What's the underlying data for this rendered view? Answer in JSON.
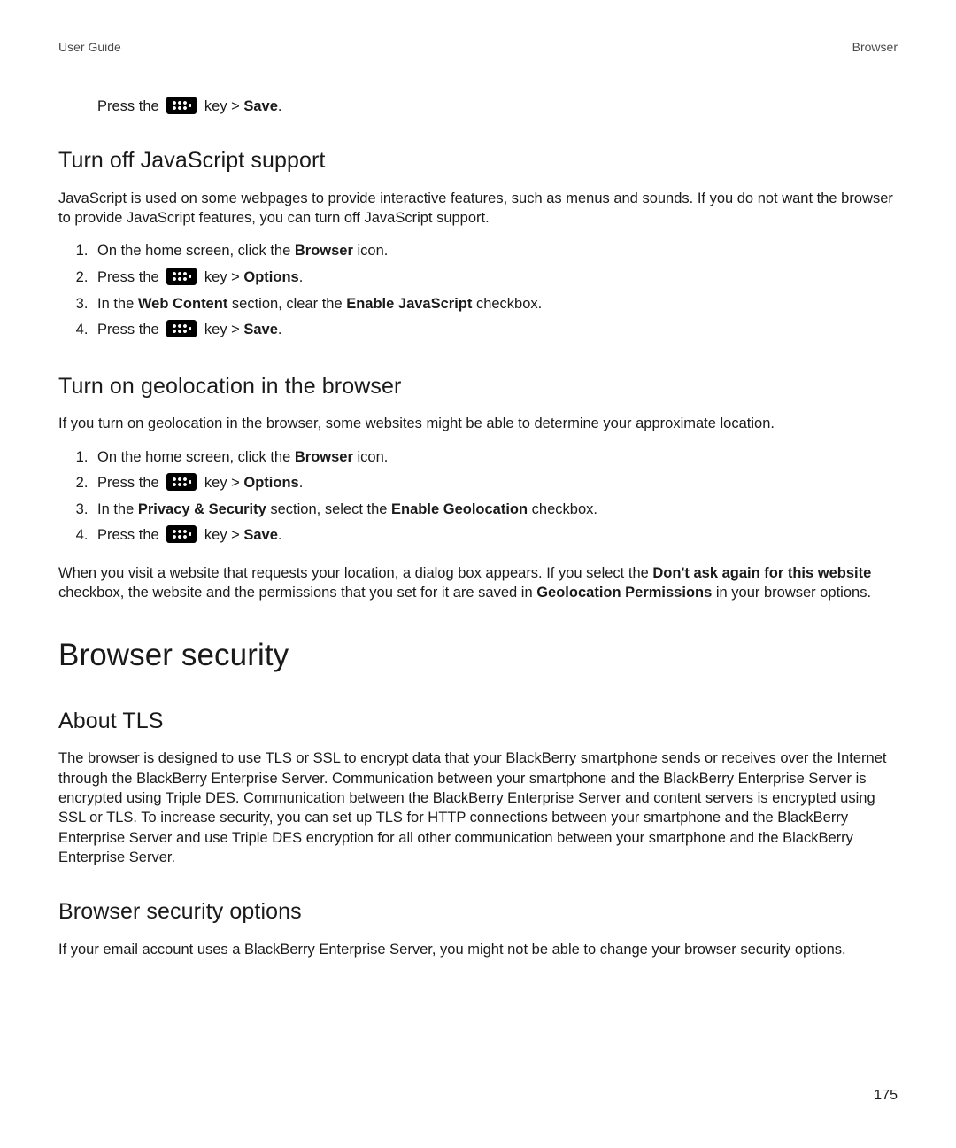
{
  "header": {
    "left": "User Guide",
    "right": "Browser"
  },
  "pageNumber": "175",
  "words": {
    "press_the": "Press the",
    "key_gt": " key > ",
    "save": "Save",
    "options": "Options",
    "period": "."
  },
  "sec1": {
    "heading": "Turn off JavaScript support",
    "intro": "JavaScript is used on some webpages to provide interactive features, such as menus and sounds. If you do not want the browser to provide JavaScript features, you can turn off JavaScript support.",
    "s1a": "On the home screen, click the ",
    "s1b": "Browser",
    "s1c": " icon.",
    "s3a": "In the ",
    "s3b": "Web Content",
    "s3c": " section, clear the ",
    "s3d": "Enable JavaScript",
    "s3e": " checkbox."
  },
  "sec2": {
    "heading": "Turn on geolocation in the browser",
    "intro": "If you turn on geolocation in the browser, some websites might be able to determine your approximate location.",
    "s1a": "On the home screen, click the ",
    "s1b": "Browser",
    "s1c": " icon.",
    "s3a": "In the ",
    "s3b": "Privacy & Security",
    "s3c": " section, select the ",
    "s3d": "Enable Geolocation",
    "s3e": " checkbox.",
    "note_a": "When you visit a website that requests your location, a dialog box appears. If you select the ",
    "note_b": "Don't ask again for this website",
    "note_c": " checkbox, the website and the permissions that you set for it are saved in ",
    "note_d": "Geolocation Permissions",
    "note_e": " in your browser options."
  },
  "secBS": {
    "heading": "Browser security"
  },
  "sec3": {
    "heading": "About TLS",
    "body": "The browser is designed to use TLS or SSL to encrypt data that your BlackBerry smartphone sends or receives over the Internet through the BlackBerry Enterprise Server. Communication between your smartphone and the BlackBerry Enterprise Server is encrypted using Triple DES. Communication between the BlackBerry Enterprise Server and content servers is encrypted using SSL or TLS. To increase security, you can set up TLS for HTTP connections between your smartphone and the BlackBerry Enterprise Server and use Triple DES encryption for all other communication between your smartphone and the BlackBerry Enterprise Server."
  },
  "sec4": {
    "heading": "Browser security options",
    "body": "If your email account uses a BlackBerry Enterprise Server, you might not be able to change your browser security options."
  }
}
